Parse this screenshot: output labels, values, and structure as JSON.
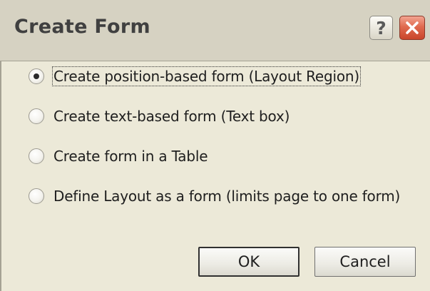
{
  "window": {
    "title": "Create Form",
    "help_glyph": "?",
    "close_icon": "close-x-icon"
  },
  "options": [
    {
      "label": "Create position-based form (Layout Region)",
      "checked": true
    },
    {
      "label": "Create text-based form (Text box)",
      "checked": false
    },
    {
      "label": "Create form in a Table",
      "checked": false
    },
    {
      "label": "Define Layout as a form (limits page to one form)",
      "checked": false
    }
  ],
  "buttons": {
    "ok": "OK",
    "cancel": "Cancel"
  },
  "colors": {
    "titlebar": "#d6d2c2",
    "dialog_bg": "#ece9d8",
    "close_button": "#e06a4f"
  }
}
